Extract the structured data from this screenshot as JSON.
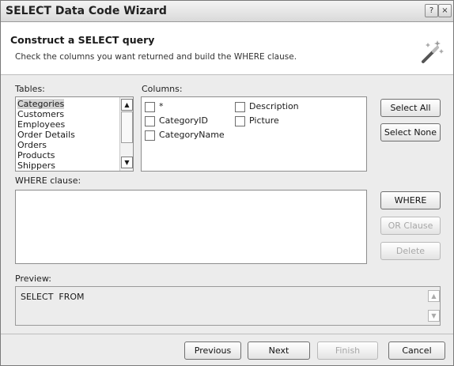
{
  "window": {
    "title": "SELECT Data Code Wizard",
    "help_glyph": "?",
    "close_glyph": "×"
  },
  "header": {
    "title": "Construct a SELECT query",
    "subtitle": "Check the columns you want returned and build the WHERE clause."
  },
  "tables": {
    "label": "Tables:",
    "items": [
      "Categories",
      "Customers",
      "Employees",
      "Order Details",
      "Orders",
      "Products",
      "Shippers"
    ],
    "selected": "Categories"
  },
  "columns": {
    "label": "Columns:",
    "items": [
      {
        "name": "*",
        "checked": false
      },
      {
        "name": "CategoryID",
        "checked": false
      },
      {
        "name": "CategoryName",
        "checked": false
      },
      {
        "name": "Description",
        "checked": false
      },
      {
        "name": "Picture",
        "checked": false
      }
    ]
  },
  "buttons": {
    "select_all": "Select All",
    "select_none": "Select None",
    "where": "WHERE",
    "or_clause": "OR Clause",
    "delete": "Delete",
    "previous": "Previous",
    "next": "Next",
    "finish": "Finish",
    "cancel": "Cancel"
  },
  "where": {
    "label": "WHERE clause:",
    "value": ""
  },
  "preview": {
    "label": "Preview:",
    "text": "SELECT  FROM"
  },
  "colors": {
    "selection": "#d4d4d4",
    "disabled_text": "#a7a7a7"
  },
  "icons": {
    "wizard": "magic-wand-icon",
    "help": "help-icon",
    "close": "close-icon"
  }
}
